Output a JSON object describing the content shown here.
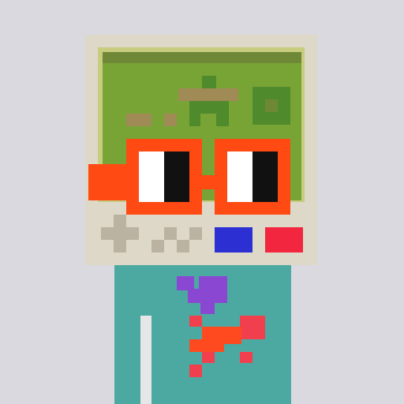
{
  "palette": {
    "background": "#d9d9df",
    "head_frame": "#ddd8c8",
    "screen_bezel": "#c7cc7e",
    "screen": "#78a436",
    "screen_dark": "#4f8a2c",
    "screen_shadow": "#6f8838",
    "screen_brown": "#a08a55",
    "glasses": "#ff4a14",
    "lens_white": "#ffffff",
    "pupil": "#111111",
    "control_gray": "#bbb3a2",
    "button_blue": "#2c2fd1",
    "button_red": "#f2263e",
    "body": "#4ca9a2",
    "body_stripe": "#e6e6e6",
    "badge_purple": "#8a47d2",
    "badge_red": "#f23f4e",
    "badge_orange": "#ff4a20"
  },
  "icons": {
    "screen_figure": "pixel-person-icon",
    "screen_block": "pixel-block-icon",
    "dpad": "dpad-icon",
    "action_buttons": "ab-buttons-icon",
    "chest_badge": "pixel-heart-icon"
  }
}
